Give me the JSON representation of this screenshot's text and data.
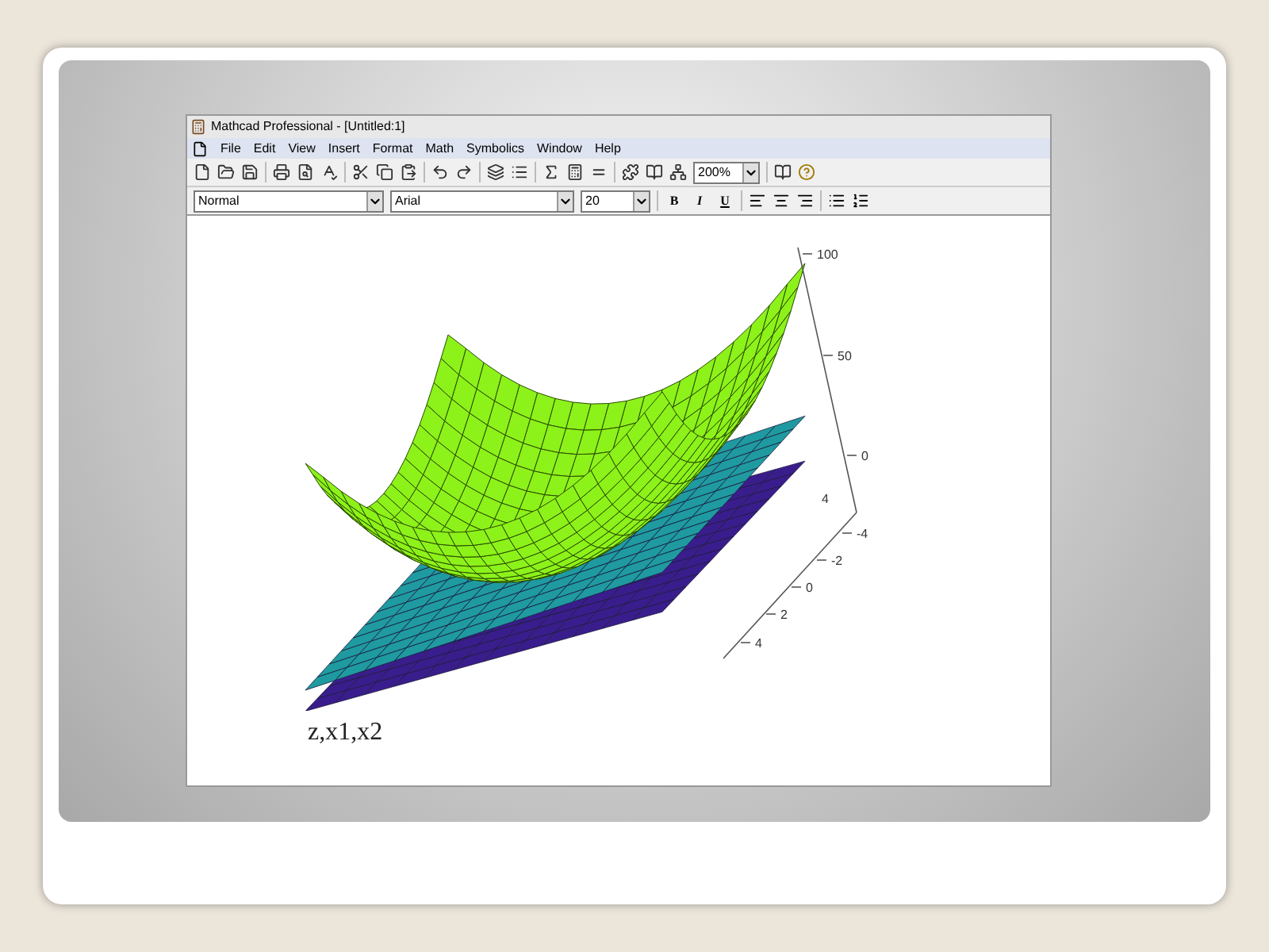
{
  "window": {
    "title": "Mathcad Professional - [Untitled:1]"
  },
  "menu": [
    "File",
    "Edit",
    "View",
    "Insert",
    "Format",
    "Math",
    "Symbolics",
    "Window",
    "Help"
  ],
  "toolbar": {
    "zoom": "200%"
  },
  "format_bar": {
    "style": "Normal",
    "font": "Arial",
    "size": "20",
    "bold": "B",
    "italic": "I",
    "underline": "U"
  },
  "plot": {
    "z_ticks": [
      "100",
      "50",
      "0"
    ],
    "corner_label": "4",
    "y_ticks": [
      "-4",
      "-2",
      "0",
      "2",
      "4"
    ],
    "label": "z,x1,x2"
  }
}
